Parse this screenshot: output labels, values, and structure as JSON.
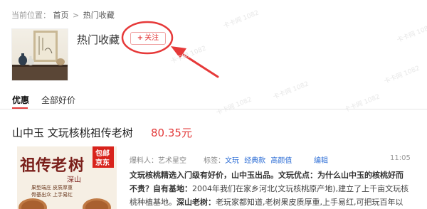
{
  "breadcrumb": {
    "prefix": "当前位置：",
    "home": "首页",
    "sep": ">",
    "current": "热门收藏"
  },
  "category": {
    "title": "热门收藏",
    "follow_label": "关注",
    "follow_icon": "plus-icon",
    "accent_color": "#e33b3b"
  },
  "tabs": [
    {
      "label": "优惠",
      "active": true
    },
    {
      "label": "全部好价",
      "active": false
    }
  ],
  "deal": {
    "title": "山中玉 文玩核桃祖传老树",
    "price": "80.35元",
    "image": {
      "headline_1": "祖传老",
      "headline_2": "树",
      "sub_origin": "深山",
      "badge_line1": "包邮",
      "badge_line2": "京东",
      "feature_1": "果型端庄 皮质厚重",
      "feature_2": "骨基出众 上手易红"
    },
    "user_label": "爆料人：",
    "user_name": "艺术星空",
    "tags_label": "标签：",
    "tags": [
      "文玩",
      "经典款",
      "高颜值"
    ],
    "edit_label": "编辑",
    "time": "11:05",
    "desc_b1": "文玩核桃精选入门级有好价，山中玉出品。文玩优点：为什么山中玉的核桃好而",
    "desc_b2": "不贵？自有基地：",
    "desc_t1": "2004年我们在家乡河北(文玩核桃原产地),建立了上千亩文玩核",
    "desc_t2": "桃种植基地。",
    "desc_b3": "深山老树：",
    "desc_t3": "老玩家都知道,老树果皮质厚重,上手易红,可把玩百年以"
  },
  "watermark": "卡卡网 1082"
}
